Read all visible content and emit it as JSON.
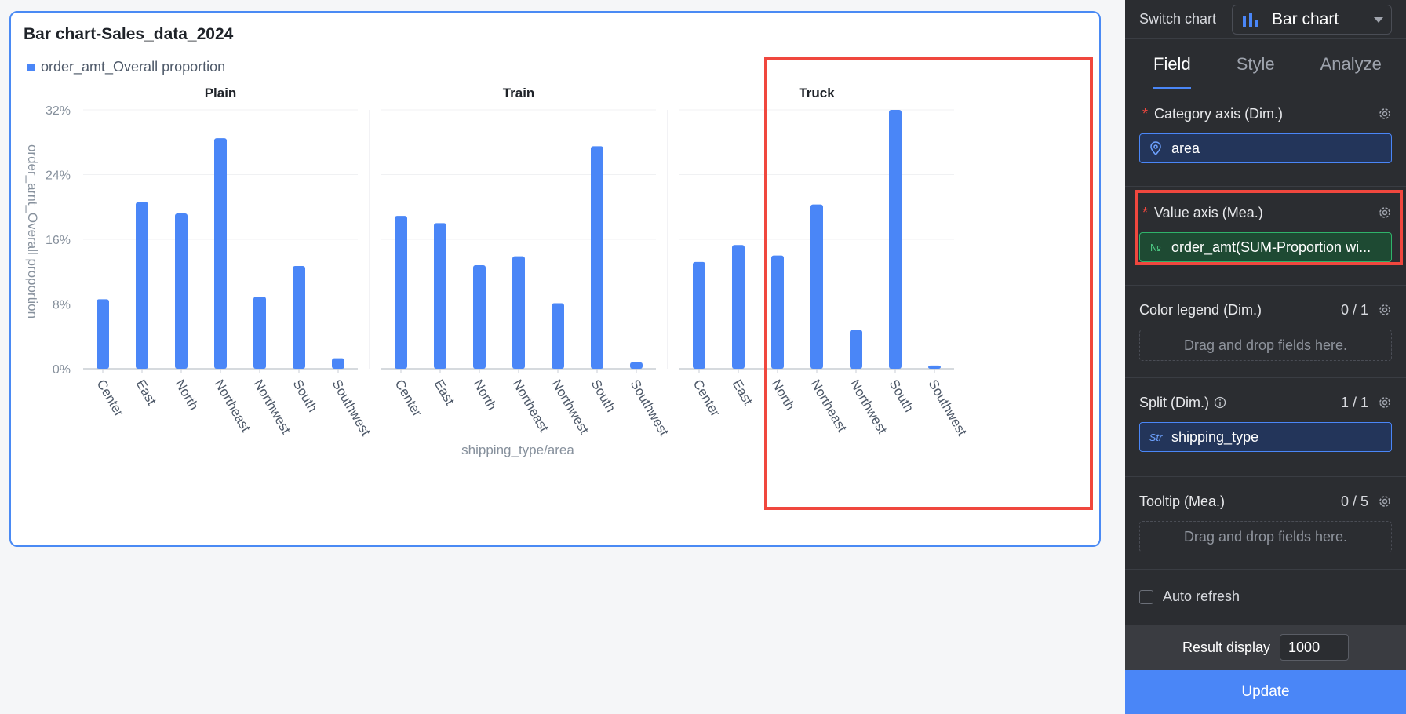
{
  "chart_card": {
    "title": "Bar chart-Sales_data_2024",
    "legend_label": "order_amt_Overall proportion"
  },
  "chart_data": {
    "type": "bar",
    "title": "Bar chart-Sales_data_2024",
    "xlabel": "shipping_type/area",
    "ylabel": "order_amt_Overall proportion",
    "ylim": [
      0,
      32
    ],
    "yticks": [
      "0%",
      "8%",
      "16%",
      "24%",
      "32%"
    ],
    "ytick_values": [
      0,
      8,
      16,
      24,
      32
    ],
    "categories": [
      "Center",
      "East",
      "North",
      "Northeast",
      "Northwest",
      "South",
      "Southwest"
    ],
    "legend": "top-left",
    "grid": true,
    "color": "#4a86f7",
    "panels": [
      {
        "name": "Plain",
        "values": [
          8.6,
          20.6,
          19.2,
          28.5,
          8.9,
          12.7,
          1.3
        ]
      },
      {
        "name": "Train",
        "values": [
          18.9,
          18.0,
          12.8,
          13.9,
          8.1,
          27.5,
          0.8
        ]
      },
      {
        "name": "Truck",
        "values": [
          13.2,
          15.3,
          14.0,
          20.3,
          4.8,
          32.0,
          0.4
        ]
      }
    ]
  },
  "panel": {
    "switch_label": "Switch chart",
    "chart_type": "Bar chart",
    "tabs": [
      {
        "label": "Field",
        "active": true
      },
      {
        "label": "Style",
        "active": false
      },
      {
        "label": "Analyze",
        "active": false
      }
    ],
    "category_axis": {
      "title": "Category axis (Dim.)",
      "required": "*",
      "field": "area"
    },
    "value_axis": {
      "title": "Value axis (Mea.)",
      "required": "*",
      "field_icon": "№",
      "field": "order_amt(SUM-Proportion wi..."
    },
    "color_legend": {
      "title": "Color legend (Dim.)",
      "count": "0 / 1",
      "placeholder": "Drag and drop fields here."
    },
    "split": {
      "title": "Split (Dim.)",
      "count": "1 / 1",
      "field_icon": "Str",
      "field": "shipping_type"
    },
    "tooltip": {
      "title": "Tooltip (Mea.)",
      "count": "0 / 5",
      "placeholder": "Drag and drop fields here."
    },
    "auto_refresh": "Auto refresh",
    "result_display_label": "Result display",
    "result_display_value": "1000",
    "update_label": "Update"
  }
}
